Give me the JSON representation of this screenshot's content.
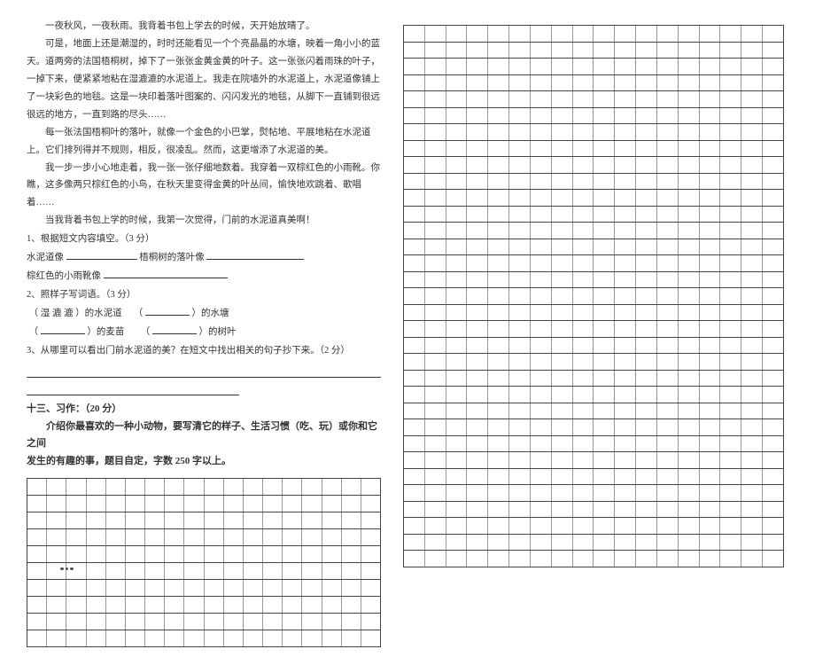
{
  "passage": {
    "p1": "一夜秋风，一夜秋雨。我背着书包上学去的时候，天开始放晴了。",
    "p2": "可是，地面上还是潮湿的，时时还能看见一个个亮晶晶的水塘，映着一角小小的蓝天。道两旁的法国梧桐树，掉下了一张张金黄金黄的叶子。这一张张闪着雨珠的叶子，一掉下来，便紧紧地粘在湿漉漉的水泥道上。我走在院墙外的水泥道上，水泥道像铺上了一块彩色的地毯。这是一块印着落叶图案的、闪闪发光的地毯，从脚下一直铺到很远很远的地方，一直到路的尽头……",
    "p3": "每一张法国梧桐叶的落叶，就像一个金色的小巴掌，熨帖地、平展地粘在水泥道上。它们排列得并不规则，相反，很凌乱。然而，这更增添了水泥道的美。",
    "p4": "我一步一步小心地走着，我一张一张仔细地数着。我穿着一双棕红色的小雨靴。你瞧，这多像两只棕红色的小鸟，在秋天里变得金黄的叶丛间，愉快地欢跳着、歌唱着……",
    "p5": "当我背着书包上学的时候，我第一次觉得，门前的水泥道真美啊！"
  },
  "questions": {
    "q1_label": "1、根据短文内容填空。（3 分）",
    "q1_a_pre": "水泥道像",
    "q1_a_mid": "梧桐树的落叶像",
    "q1_b_pre": "棕红色的小雨靴像",
    "q2_label": "2、照样子写词语。（3 分）",
    "q2_a_pre": "（ 湿 漉 漉 ）的水泥道",
    "q2_a_paren_l": "（",
    "q2_a_paren_r": "）的水塘",
    "q2_b_paren1_l": "（",
    "q2_b_paren1_r": "）的麦苗",
    "q2_b_paren2_l": "（",
    "q2_b_paren2_r": "）的树叶",
    "q3_label": "3、从哪里可以看出门前水泥道的美？在短文中找出相关的句子抄下来。（2 分）"
  },
  "section": {
    "title": "十三、习作：（20 分）",
    "line1": "介绍你最喜欢的一种小动物，要写清它的样子、生活习惯（吃、玩）或你和它之间",
    "line2": "发生的有趣的事，题目自定，字数 250 字以上。"
  },
  "grid": {
    "left_cols": 18,
    "left_rows": 10,
    "right_cols": 18,
    "right_rows": 33
  }
}
